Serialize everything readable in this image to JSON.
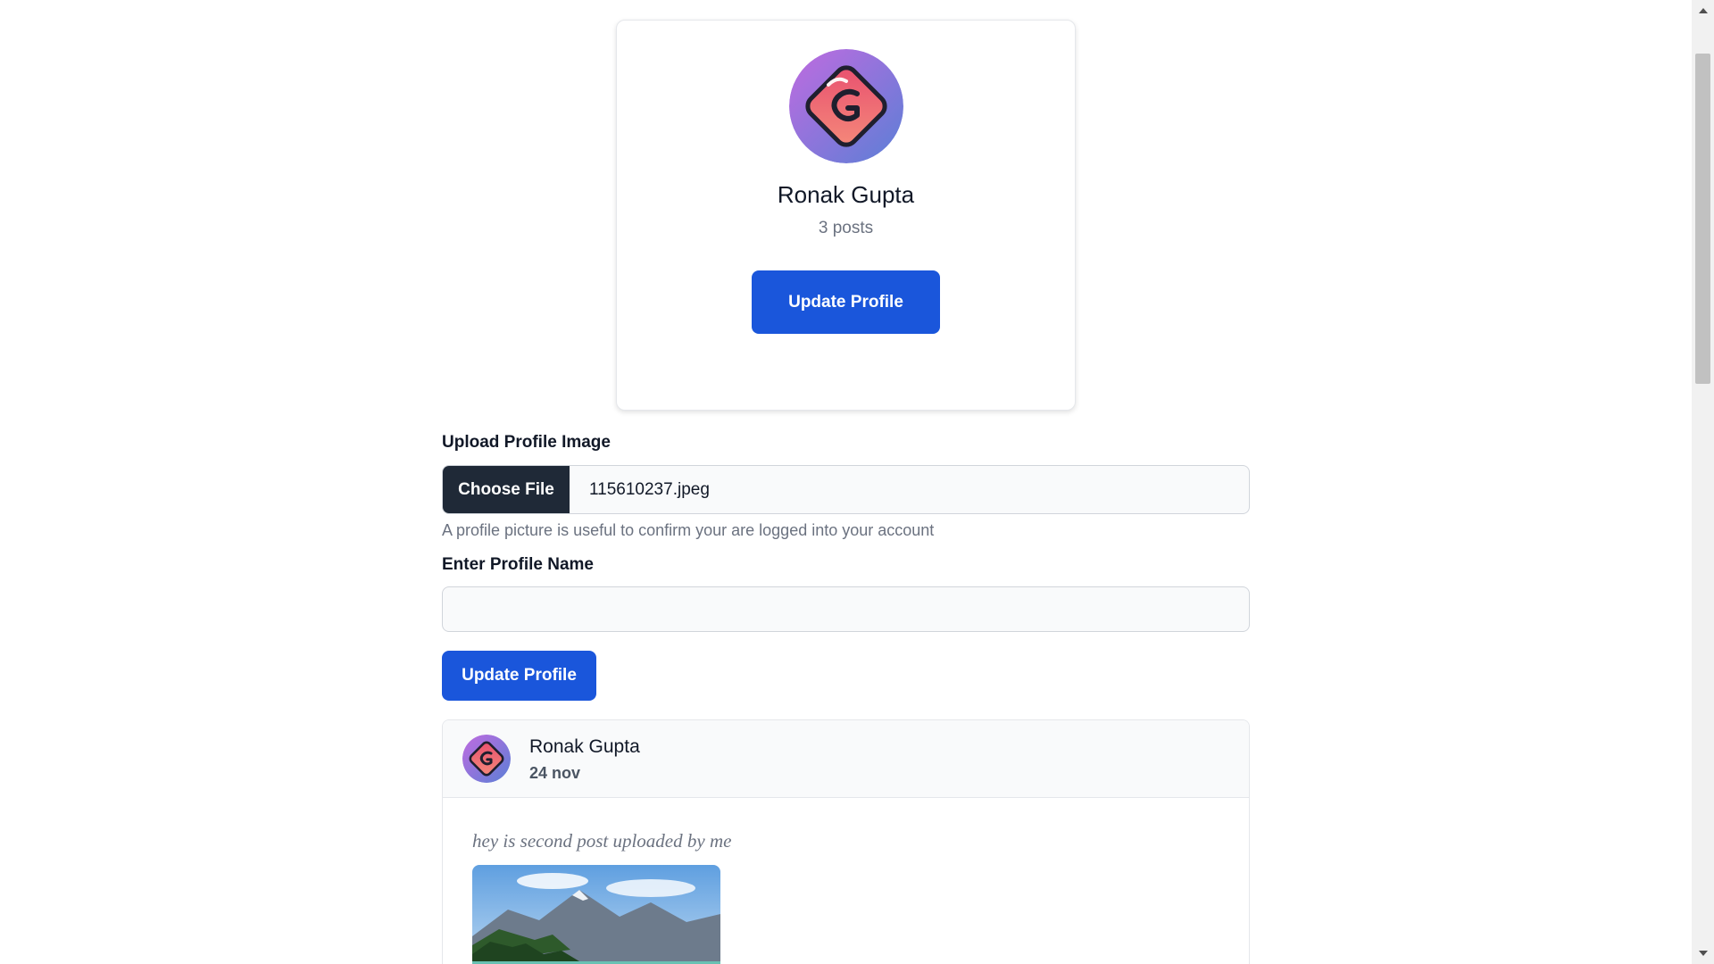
{
  "profile_card": {
    "name": "Ronak Gupta",
    "posts": "3 posts",
    "update_button": "Update Profile"
  },
  "form": {
    "upload_label": "Upload Profile Image",
    "choose_file_button": "Choose File",
    "selected_file": "115610237.jpeg",
    "helper_text": "A profile picture is useful to confirm your are logged into your account",
    "name_label": "Enter Profile Name",
    "name_value": "",
    "name_placeholder": "",
    "update_button": "Update Profile"
  },
  "post": {
    "author": "Ronak Gupta",
    "date": "24 nov",
    "text": "hey is second post uploaded by me"
  },
  "colors": {
    "primary": "#1a56db",
    "file_button": "#1f2937",
    "muted_text": "#6b7280"
  },
  "icons": {
    "avatar": "logo-avatar-icon",
    "scroll_up": "scroll-up-arrow-icon",
    "scroll_down": "scroll-down-arrow-icon"
  }
}
